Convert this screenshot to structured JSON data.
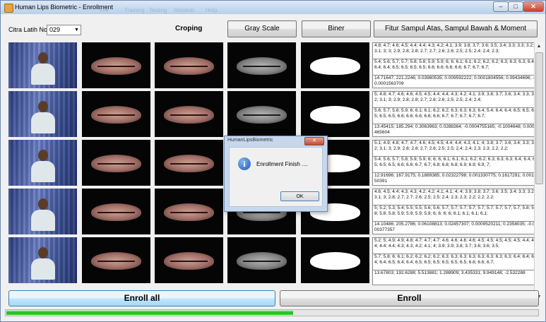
{
  "window": {
    "title": "Human Lips Biometric - Enrollment",
    "minimize": "–",
    "maximize": "□",
    "close": "✕",
    "background_menu": [
      "File",
      "Training",
      "Testing",
      "Relation",
      "Help"
    ]
  },
  "toolbar": {
    "citra_label": "Citra Latih No",
    "citra_value": "029",
    "croping_label": "Croping",
    "grayscale_button": "Gray Scale",
    "biner_button": "Biner",
    "fitur_button": "Fitur Sampul Atas, Sampul Bawah & Moment"
  },
  "rows": [
    {
      "fitur_atas": "4.8; 4.7; 4.6; 4.5; 4.4; 4.4; 4.3; 4.2; 4.1; 3.9; 3.8; 3.7; 3.6; 3.5; 3.4; 3.3; 3.3; 3.2; 3.1; 3; 3; 2.9; 2.8; 2.8; 2.7; 2.7; 2.6; 2.6; 2.5; 2.5; 2.4; 2.4; 2.3;",
      "fitur_bawah": "5.4; 5.6; 5.7; 5.7; 5.8; 5.8; 5.9; 5.9; 6; 6; 6.1; 6.1; 6.2; 6.2; 6.2; 6.3; 6.3; 6.3; 6.4; 6.4; 6.4; 6.5; 6.5; 6.5; 6.5; 6.6; 6.6; 6.6; 6.6; 6.7; 6.7; 6.7;",
      "moment": "14.71647; 221.2246; 0.03980535; 0.009592222; 0.0001804556; 0.09434696; -0.0001563709"
    },
    {
      "fitur_atas": "5; 4.8; 4.7; 4.6; 4.6; 4.5; 4.5; 4.4; 4.4; 4.3; 4.2; 4.1; 3.9; 3.8; 3.7; 3.6; 3.4; 3.3; 3.2; 3.1; 3; 2.9; 2.8; 2.8; 2.7; 2.6; 2.6; 2.5; 2.5; 2.4; 2.4;",
      "fitur_bawah": "5.6; 5.7; 5.8; 5.9; 6; 6.1; 6.1; 6.2; 6.2; 6.3; 6.3; 6.3; 6.4; 5.4; 6.4; 6.4; 6.5; 6.5; 6.5; 6.5; 6.5; 6.6; 6.6; 6.6; 6.6; 6.6; 6.7; 6.7; 6.7; 6.7; 6.7;",
      "moment": "13.45415; 185.294; 0.3063963; 0.0288364; -0.0004755165; -0.1004648; 0.0007465604"
    },
    {
      "fitur_atas": "5.1; 4.9; 4.8; 4.7; 4.7; 4.6; 4.5; 4.5; 4.4; 4.4; 4.3; 4.1; 4; 3.8; 3.7; 3.6; 3.4; 3.3; 3.2; 3.1; 3; 2.9; 2.8; 2.8; 2.7; 2.6; 2.5; 2.5; 2.4; 2.4; 2.3; 2.3; 2.2; 2.2;",
      "fitur_bawah": "5.4; 5.6; 5.7; 5.8; 5.9; 5.9; 6; 6; 6; 6.1; 6.1; 6.1; 6.2; 6.2; 6.3; 6.3; 6.3; 6.4; 6.4; 6.5; 6.5; 6.5; 6.6; 6.6; 6.7; 6.7; 6.8; 6.8; 6.8; 6.9; 6.9; 6.9; 7;",
      "moment": "12.91696; 167.9175; 0.1889385; 0.02322798; 0.001330775; 0.1617291; 0.001450391"
    },
    {
      "fitur_atas": "4.6; 4.5; 4.4; 4.3; 4.3; 4.2; 4.2; 4.1; 4.1; 4; 4; 3.9; 3.8; 3.7; 3.6; 3.5; 3.4; 3.3; 3.2; 3.1; 3; 2.8; 2.7; 2.7; 2.6; 2.5; 2.5; 2.4; 2.3; 2.3; 2.2; 2.2; 2.2;",
      "fitur_bawah": "5; 5.2; 5.3; 5.4; 5.5; 5.5; 5.6; 5.6; 5.7; 5.7; 5.7; 5.7; 5.7; 5.7; 5.7; 5.7; 5.7; 5.8; 5.8; 5.8; 5.8; 5.9; 5.9; 5.9; 5.9; 6; 6; 6; 6; 6.1; 6.1; 6.1; 6.1;",
      "moment": "14.10486; 205.2786; 0.06108813; 0.02457307; 0.0009520211; 0.2358035; -0.000377357"
    },
    {
      "fitur_atas": "5.2; 5; 4.9; 4.9; 4.8; 4.7; 4.7; 4.7; 4.6; 4.6; 4.6; 4.6; 4.5; 4.5; 4.5; 4.5; 4.5; 4.4; 4.4; 4.4; 4.4; 4.3; 4.3; 4.2; 4.1; 4; 3.9; 3.9; 3.8; 3.7; 3.6; 3.6; 3.5;",
      "fitur_bawah": "5.7; 5.8; 6; 6.1; 6.2; 6.2; 6.2; 6.2; 6.3; 6.3; 6.3; 6.3; 6.3; 6.3; 6.3; 6.3; 6.4; 6.4; 6.4; 6.4; 6.5; 6.4; 6.4; 6.5; 6.5; 6.5; 6.5; 6.5; 6.5; 6.6; 6.6; 6.7;",
      "moment": "13.67803; 192.6288; 5.513881; 1.288909; 3.435331; 9.949148; -2.532288"
    }
  ],
  "actions": {
    "enroll_all": "Enroll all",
    "enroll": "Enroll"
  },
  "progress": {
    "fraction": 0.54
  },
  "dialog": {
    "title": "HumanLipsBiometric",
    "close": "✕",
    "message": "Enrollment Finish ....",
    "ok": "OK",
    "icon": "info-icon"
  },
  "colors": {
    "window_bg": "#f0f0f0",
    "progress_fill": "#2fc42f",
    "enroll_all_highlight": "#bee6fd"
  }
}
